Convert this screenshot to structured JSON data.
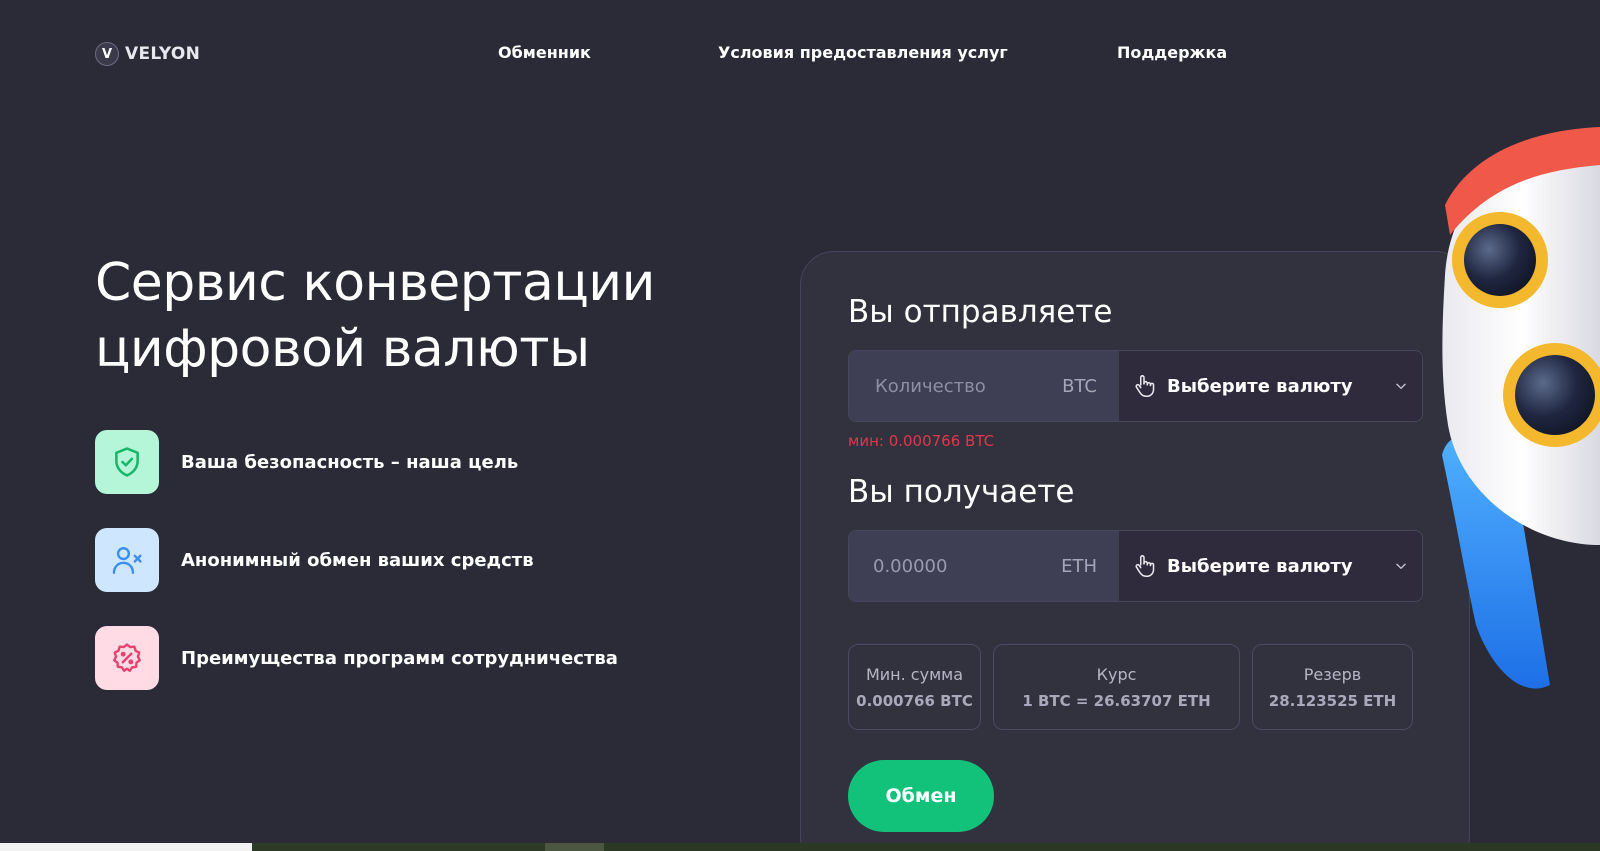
{
  "header": {
    "logo_letter": "V",
    "logo_text": "VELYON",
    "nav": [
      {
        "label": "Обменник"
      },
      {
        "label": "Условия предоставления услуг"
      },
      {
        "label": "Поддержка"
      }
    ]
  },
  "hero": {
    "title_line1": "Сервис конвертации",
    "title_line2": "цифровой валюты",
    "features": [
      {
        "label": "Ваша безопасность – наша цель",
        "icon": "shield-check-icon",
        "bg": "#b5f5d8",
        "color": "#19b56a"
      },
      {
        "label": "Анонимный обмен ваших средств",
        "icon": "user-x-icon",
        "bg": "#cfe6ff",
        "color": "#3b8ff0"
      },
      {
        "label": "Преимущества программ сотрудничества",
        "icon": "discount-badge-icon",
        "bg": "#ffdbe5",
        "color": "#e8436e"
      }
    ]
  },
  "exchange": {
    "send": {
      "title": "Вы отправляете",
      "amount_placeholder": "Количество",
      "ticker": "BTC",
      "select_label": "Выберите валюту",
      "min_note": "мин: 0.000766 BTC"
    },
    "receive": {
      "title": "Вы получаете",
      "amount_value": "0.00000",
      "ticker": "ETH",
      "select_label": "Выберите валюту"
    },
    "stats": [
      {
        "label": "Мин. сумма",
        "value": "0.000766 BTC"
      },
      {
        "label": "Курс",
        "value": "1 BTC = 26.63707 ETH"
      },
      {
        "label": "Резерв",
        "value": "28.123525 ETH"
      }
    ],
    "button_label": "Обмен"
  },
  "colors": {
    "background": "#2b2b37",
    "card": "#32323f",
    "accent_green": "#12c27b",
    "error_red": "#e2364b"
  }
}
